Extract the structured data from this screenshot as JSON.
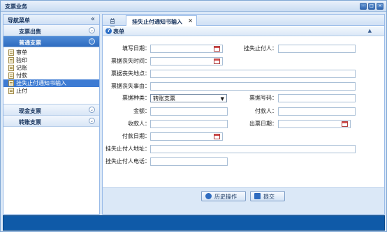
{
  "window": {
    "title": "支票业务",
    "controls": [
      "minimize-icon",
      "maximize-icon",
      "close-icon"
    ]
  },
  "sidebar": {
    "title": "导航菜单",
    "collapse_glyph": "«",
    "groups": [
      {
        "label": "支票出售",
        "expanded": false
      },
      {
        "label": "普通支票",
        "expanded": true,
        "items": [
          "审单",
          "验印",
          "记账",
          "付款",
          "挂失止付通知书输入",
          "止付"
        ],
        "selected": "挂失止付通知书输入"
      },
      {
        "label": "现金支票",
        "expanded": false
      },
      {
        "label": "转账支票",
        "expanded": false
      }
    ]
  },
  "tabs": {
    "home": "首页",
    "active": "挂失止付通知书输入",
    "close_glyph": "×"
  },
  "panel": {
    "title": "表单",
    "collapse_glyph": "▲"
  },
  "form": {
    "fill_date_label": "填写日期：",
    "stop_payer_label": "挂失止付人：",
    "lost_time_label": "票据丧失时间：",
    "lost_place_label": "票据丧失地点：",
    "lost_reason_label": "票据丧失事由：",
    "type_label": "票据种类：",
    "type_value": "转账支票",
    "number_label": "票据号码：",
    "amount_label": "金额：",
    "payer_label": "付款人：",
    "payee_label": "收款人：",
    "issue_date_label": "出票日期：",
    "pay_date_label": "付款日期：",
    "address_label": "挂失止付人地址：",
    "phone_label": "挂失止付人电话："
  },
  "buttons": {
    "history": "历史操作",
    "submit": "提交"
  },
  "colors": {
    "accent": "#2f6cc0",
    "status_bar": "#0f5aa8",
    "selection": "#3d7bd3"
  }
}
